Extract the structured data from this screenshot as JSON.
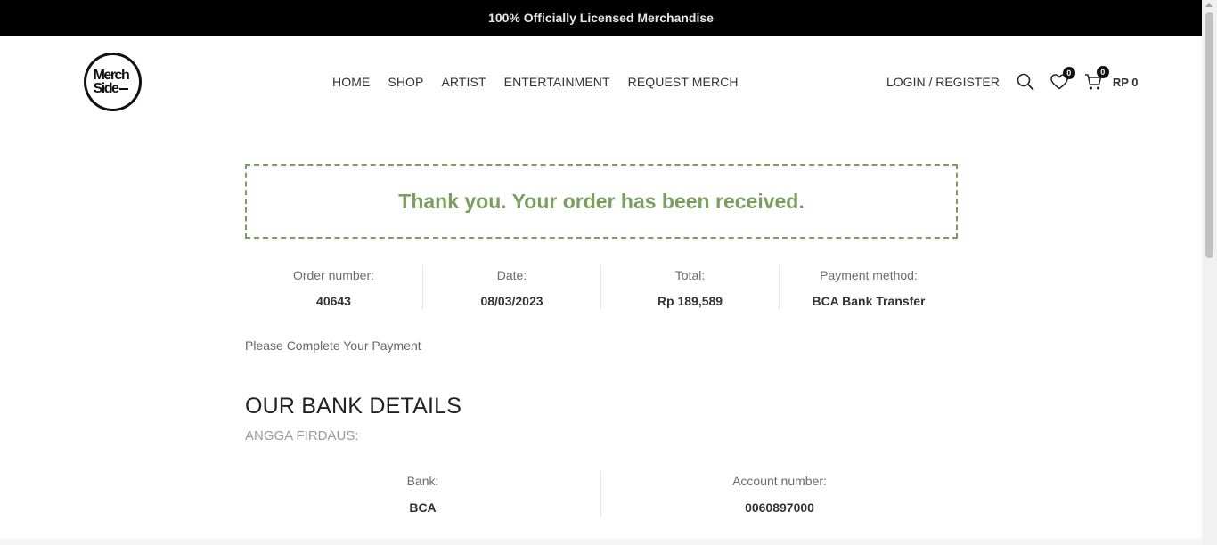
{
  "topbar": {
    "text": "100% Officially Licensed Merchandise"
  },
  "logo": {
    "line1": "Merch",
    "line2": "Side"
  },
  "nav": {
    "items": [
      "HOME",
      "SHOP",
      "ARTIST",
      "ENTERTAINMENT",
      "REQUEST MERCH"
    ]
  },
  "header": {
    "login_label": "LOGIN / REGISTER",
    "wishlist_count": "0",
    "cart_count": "0",
    "cart_total": "RP 0",
    "icons": [
      "search-icon",
      "heart-icon",
      "cart-icon"
    ]
  },
  "notice": {
    "text": "Thank you. Your order has been received.",
    "color": "#7a9e5e"
  },
  "overview": [
    {
      "label": "Order number:",
      "value": "40643"
    },
    {
      "label": "Date:",
      "value": "08/03/2023"
    },
    {
      "label": "Total:",
      "value": "Rp 189,589"
    },
    {
      "label": "Payment method:",
      "value": "BCA Bank Transfer"
    }
  ],
  "payment_note": "Please Complete Your Payment",
  "bank": {
    "title": "OUR BANK DETAILS",
    "owner": "ANGGA FIRDAUS:",
    "details": [
      {
        "label": "Bank:",
        "value": "BCA"
      },
      {
        "label": "Account number:",
        "value": "0060897000"
      }
    ]
  }
}
